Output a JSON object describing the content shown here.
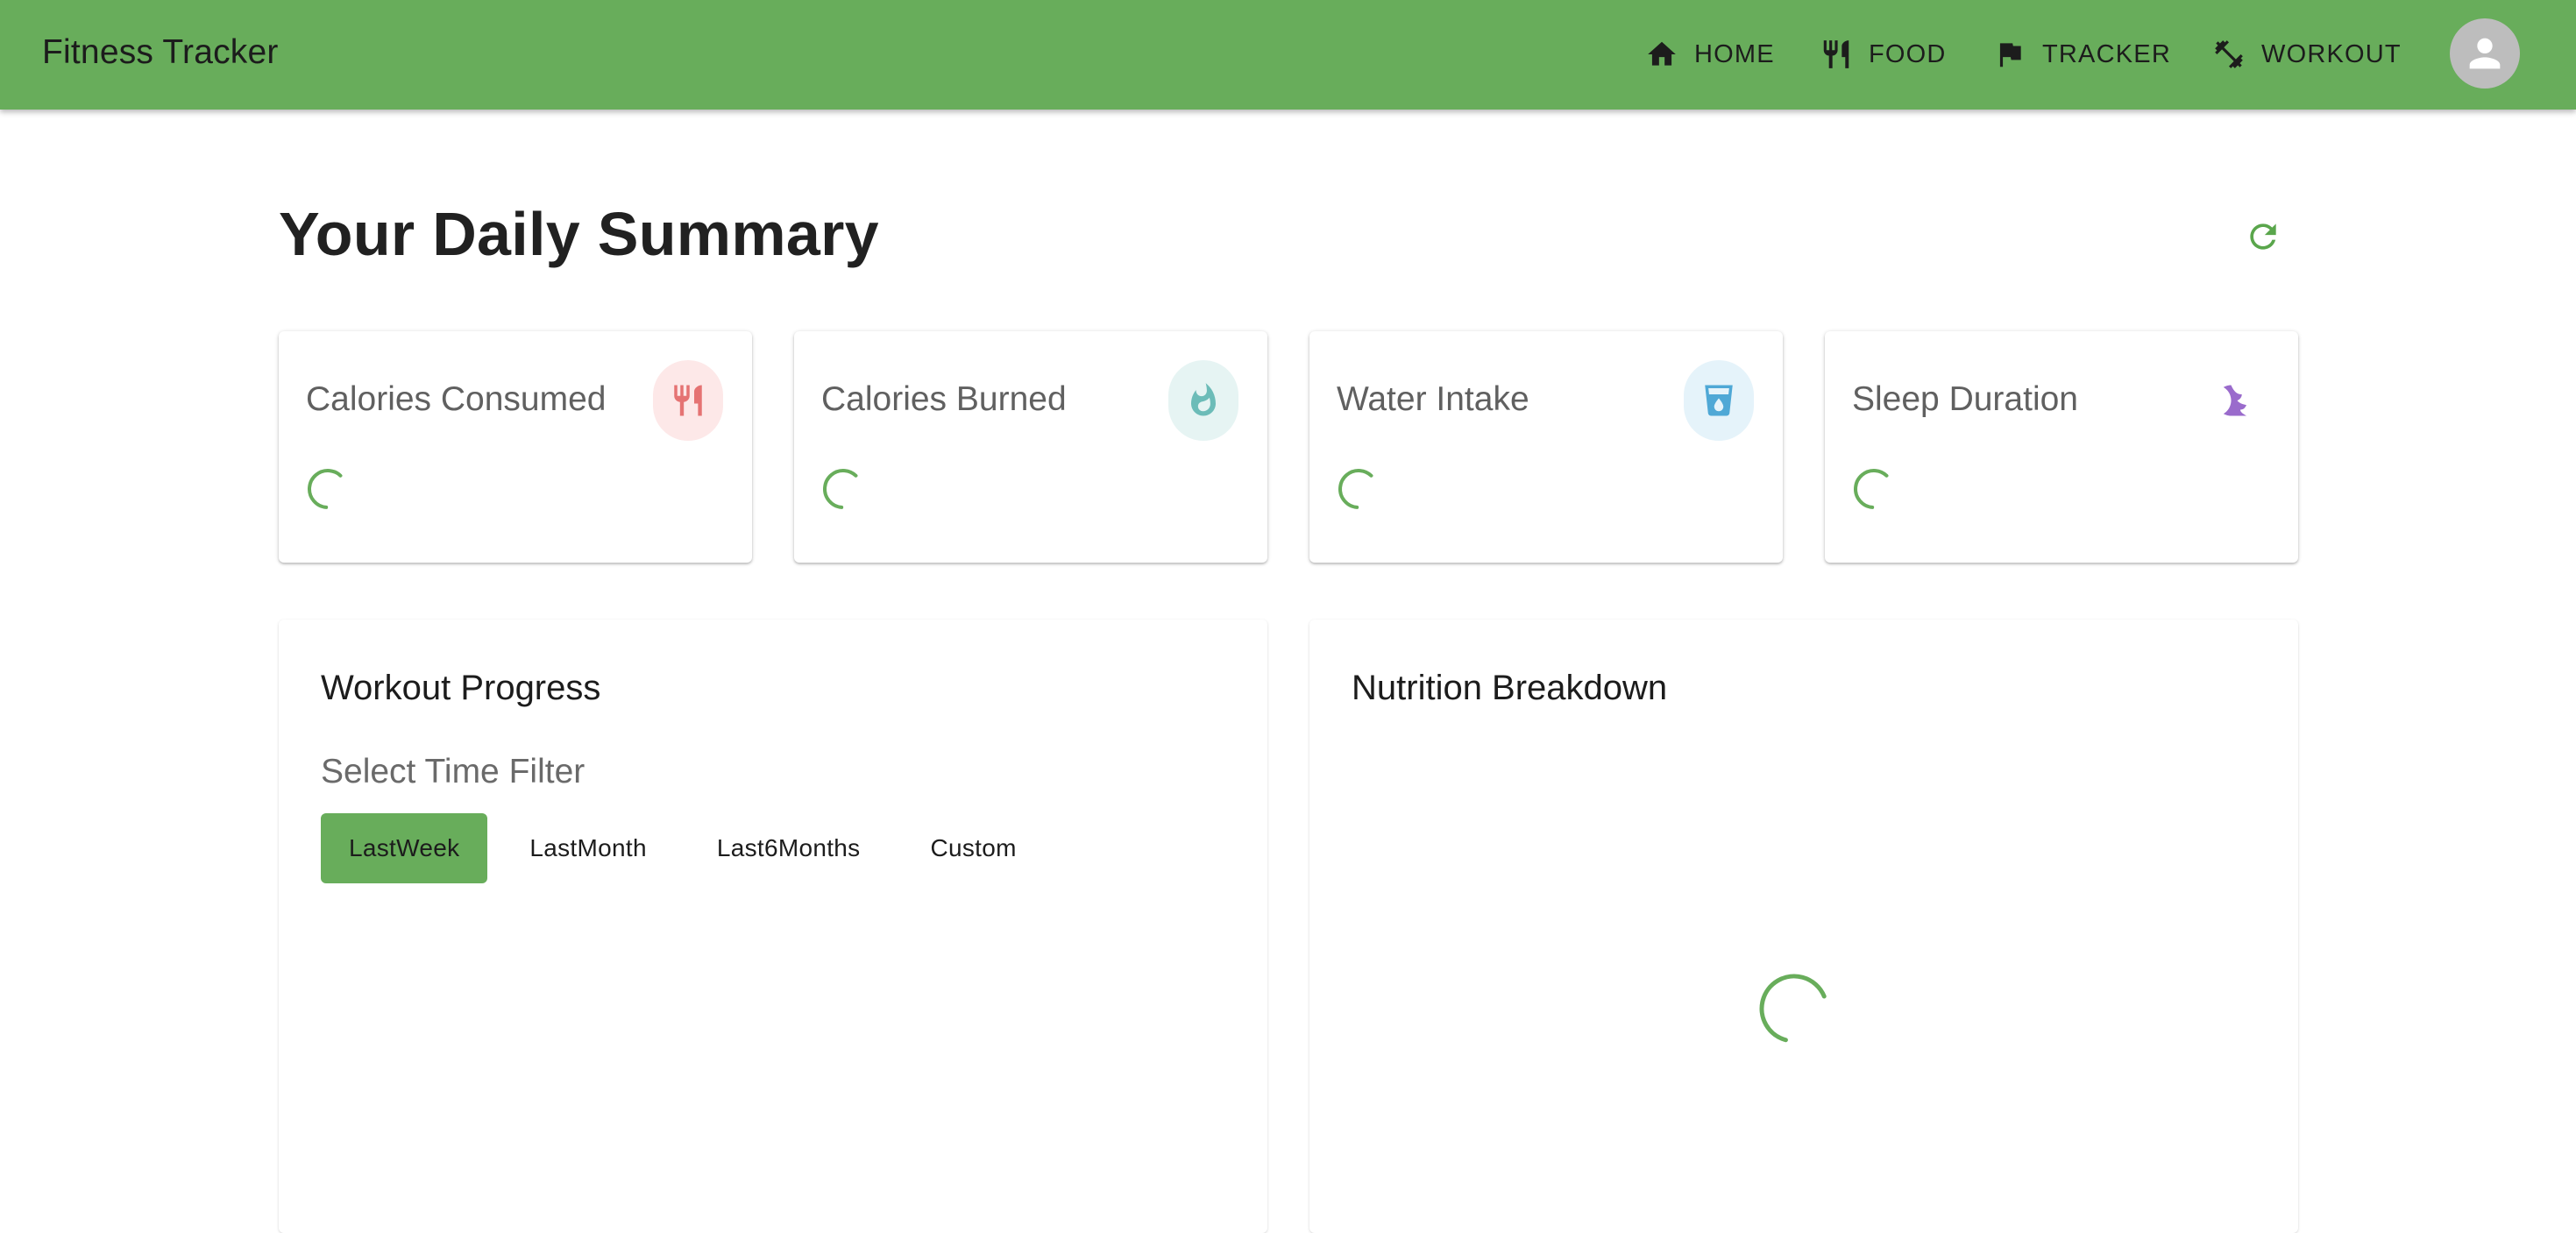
{
  "appbar": {
    "title": "Fitness Tracker",
    "nav": [
      {
        "label": "HOME",
        "icon": "home-icon"
      },
      {
        "label": "FOOD",
        "icon": "utensils-icon"
      },
      {
        "label": "TRACKER",
        "icon": "flag-icon"
      },
      {
        "label": "WORKOUT",
        "icon": "workout-icon"
      }
    ],
    "avatar_icon": "user-icon"
  },
  "colors": {
    "primary": "#68ad5b",
    "accent_green": "#5aa64c",
    "calories_consumed": "#e57373",
    "calories_burned": "#6cbcb8",
    "water": "#4fa8d6",
    "sleep": "#9a6bcc"
  },
  "summary": {
    "title": "Your Daily Summary",
    "refresh_icon": "refresh-icon",
    "cards": [
      {
        "label": "Calories Consumed",
        "icon": "utensils-icon",
        "status": "loading"
      },
      {
        "label": "Calories Burned",
        "icon": "flame-icon",
        "status": "loading"
      },
      {
        "label": "Water Intake",
        "icon": "water-glass-icon",
        "status": "loading"
      },
      {
        "label": "Sleep Duration",
        "icon": "moon-icon",
        "status": "loading"
      }
    ]
  },
  "workout": {
    "title": "Workout Progress",
    "filter_label": "Select Time Filter",
    "filters": [
      "LastWeek",
      "LastMonth",
      "Last6Months",
      "Custom"
    ],
    "selected_filter": "LastWeek"
  },
  "nutrition": {
    "title": "Nutrition Breakdown",
    "status": "loading"
  }
}
